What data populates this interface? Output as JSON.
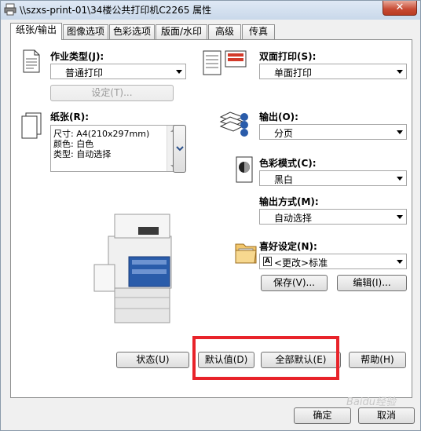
{
  "window": {
    "title": "\\\\szxs-print-01\\34楼公共打印机C2265 属性",
    "close_label": "✕"
  },
  "tabs": [
    {
      "label": "纸张/输出",
      "active": true
    },
    {
      "label": "图像选项",
      "active": false
    },
    {
      "label": "色彩选项",
      "active": false
    },
    {
      "label": "版面/水印",
      "active": false
    },
    {
      "label": "高级",
      "active": false
    },
    {
      "label": "传真",
      "active": false
    }
  ],
  "job_type": {
    "label": "作业类型(J):",
    "value": "普通打印",
    "settings_button": "设定(T)..."
  },
  "paper": {
    "label": "纸张(R):",
    "lines": [
      "尺寸: A4(210x297mm)",
      "颜色: 白色",
      "类型: 自动选择"
    ],
    "more_icon": "chevron-down-icon"
  },
  "duplex": {
    "label": "双面打印(S):",
    "value": "单面打印"
  },
  "output": {
    "label": "输出(O):",
    "value": "分页"
  },
  "color_mode": {
    "label": "色彩模式(C):",
    "value": "黑白"
  },
  "output_method": {
    "label": "输出方式(M):",
    "value": "自动选择"
  },
  "favorites": {
    "label": "喜好设定(N):",
    "value": "<更改>标准",
    "save_button": "保存(V)...",
    "edit_button": "编辑(I)..."
  },
  "buttons": {
    "status": "状态(U)",
    "default": "默认值(D)",
    "all_default": "全部默认(E)",
    "help": "帮助(H)"
  },
  "dialog": {
    "ok": "确定",
    "cancel": "取消"
  },
  "watermark": "Baidu经验",
  "colors": {
    "highlight": "#e8232a",
    "accent_blue": "#2a5caa"
  }
}
